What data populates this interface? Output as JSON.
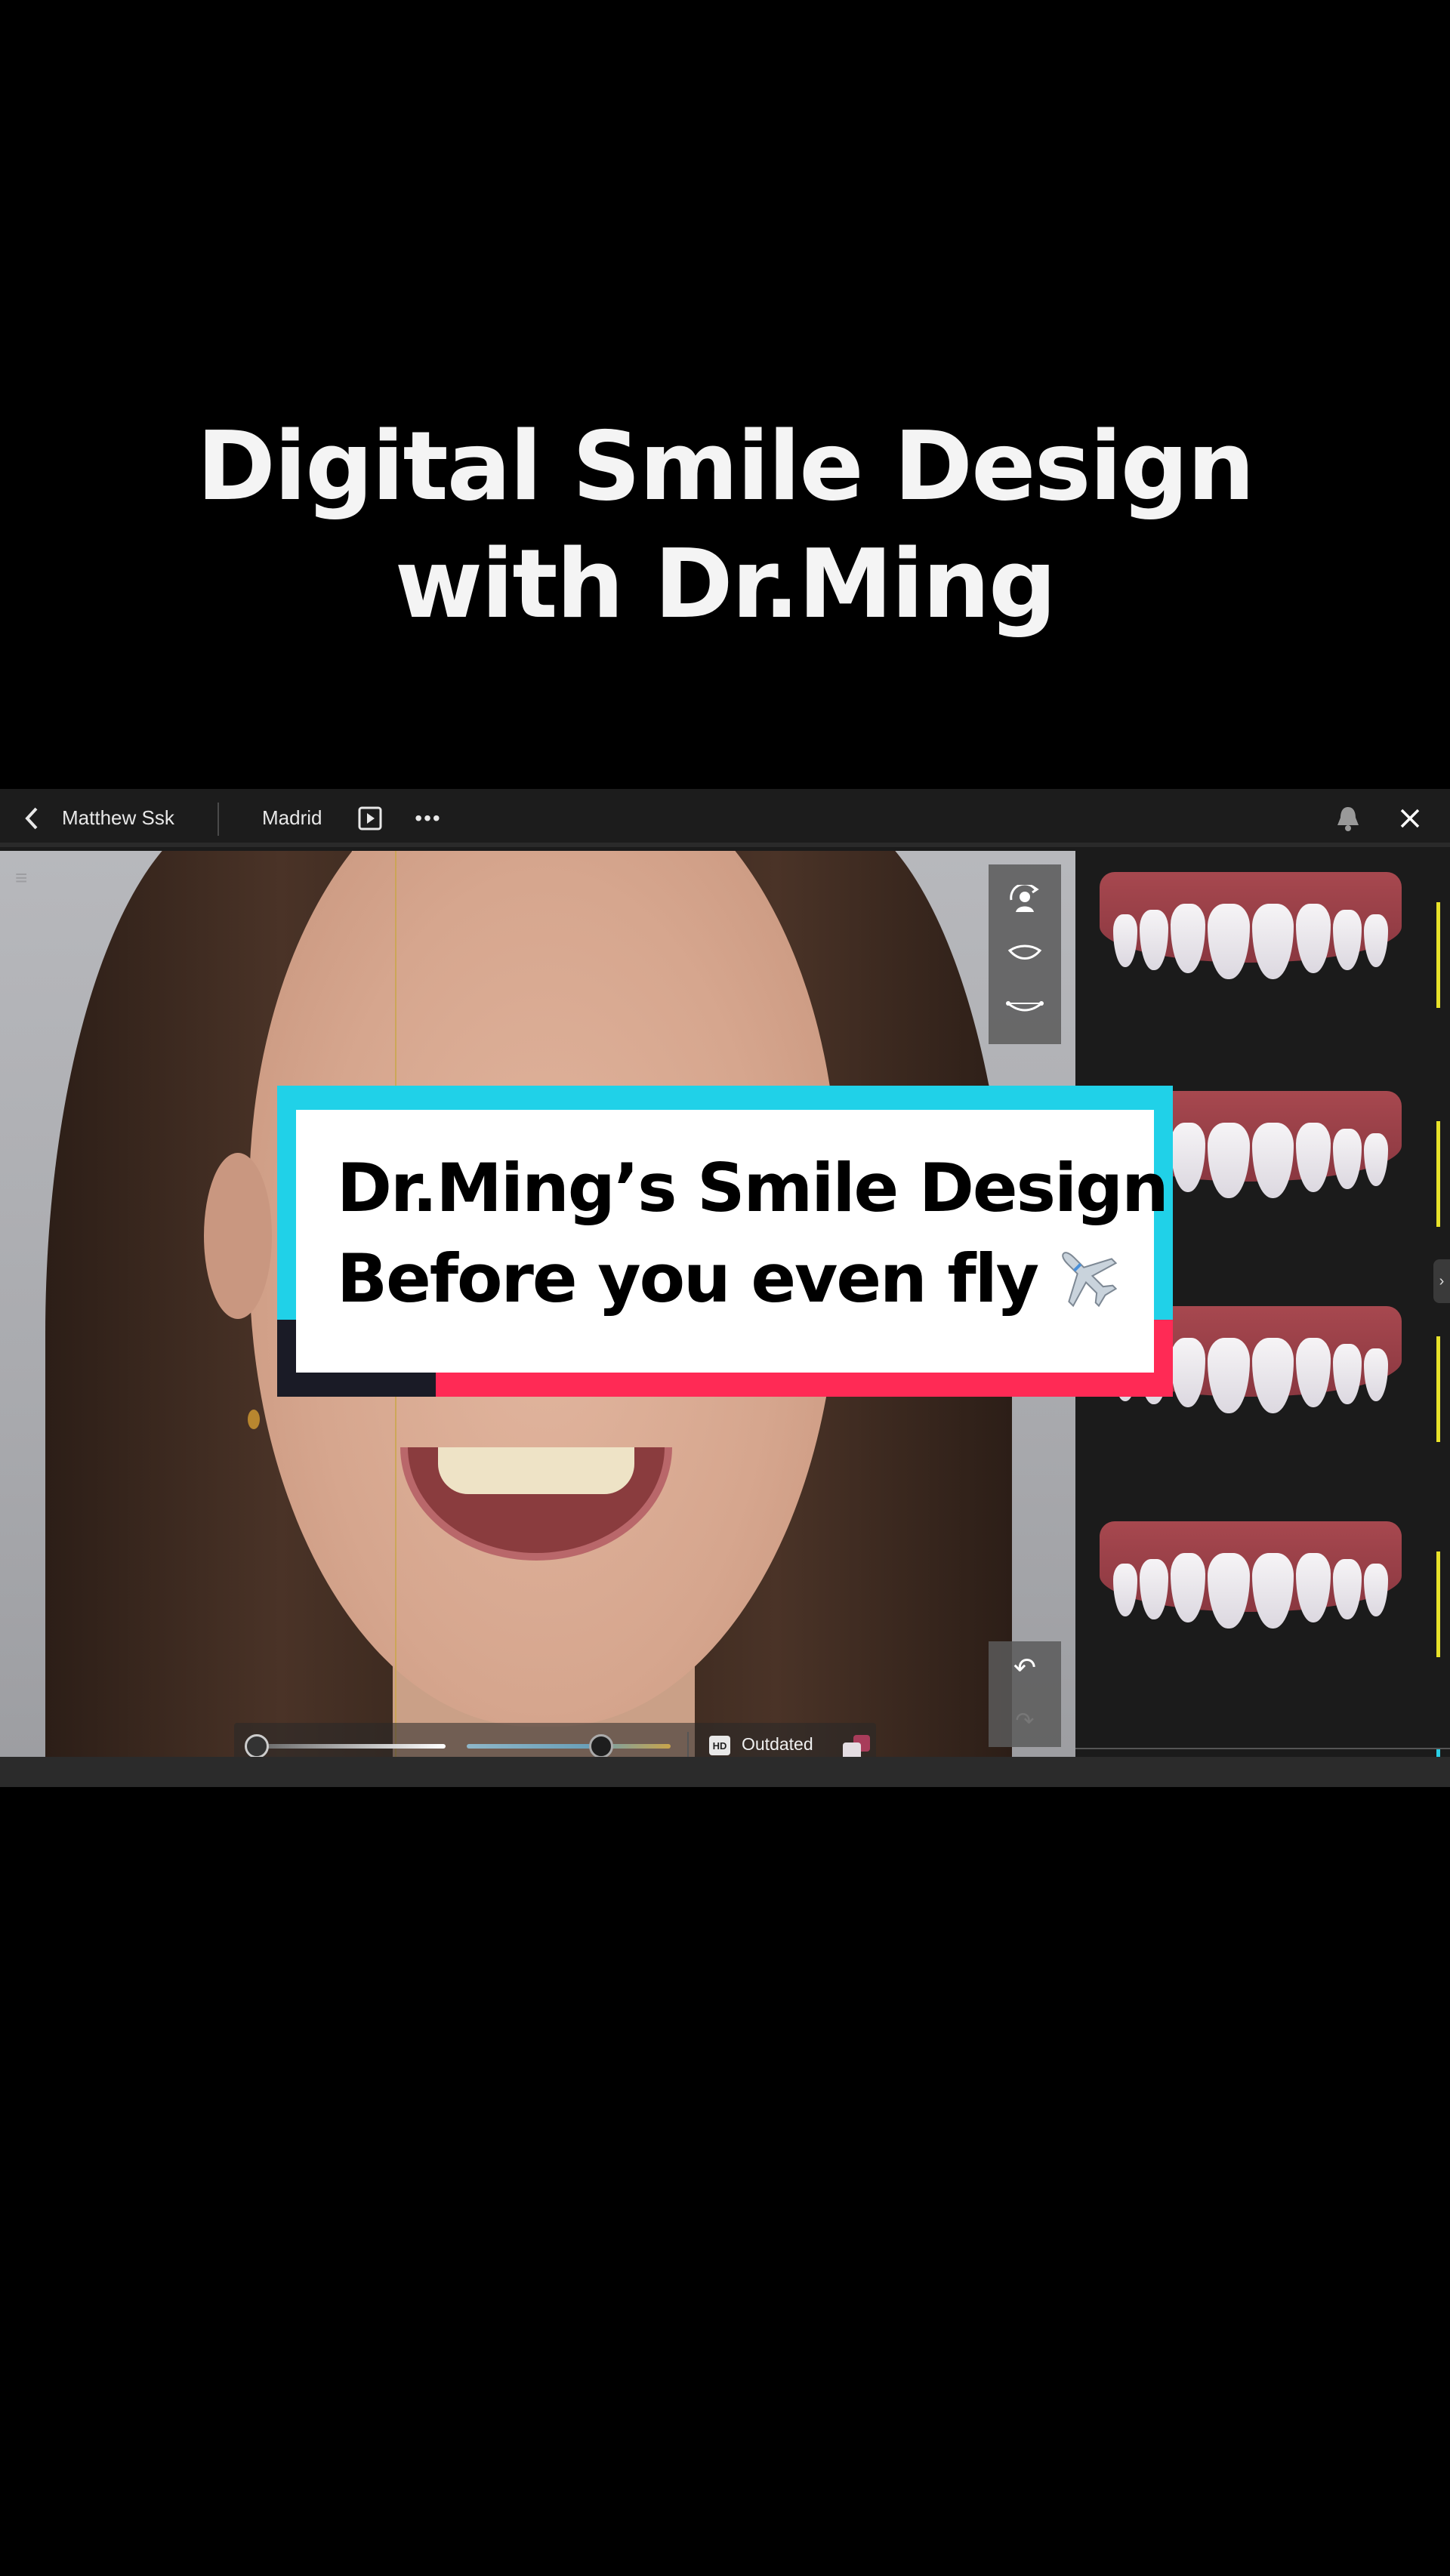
{
  "headline": {
    "line1": "Digital Smile Design",
    "line2": "with Dr.Ming"
  },
  "topbar": {
    "back_icon": "‹",
    "patient_name": "Matthew Ssk",
    "location": "Madrid",
    "play_icon": "▶",
    "more_icon": "•••",
    "close_icon": "✕"
  },
  "toolbar": {
    "tools": [
      "face-rotate-icon",
      "lip-curve-icon",
      "smile-arc-icon"
    ],
    "undo_icon": "↶",
    "redo_icon": "↷"
  },
  "bottom_bar": {
    "hd_label": "HD",
    "status": "Outdated",
    "slider_a_value": 0,
    "slider_b_value": 0.72
  },
  "library": {
    "item_count": 4,
    "expand_icon": "›",
    "selected_color": "#e8e22a"
  },
  "caption": {
    "line1": "Dr.Ming’s Smile Design",
    "line2": "Before you even fly",
    "emoji": "✈️"
  },
  "colors": {
    "caption_frame": "#20d1e8",
    "caption_accent": "#ff2a55",
    "caption_dark": "#1a1b26"
  }
}
